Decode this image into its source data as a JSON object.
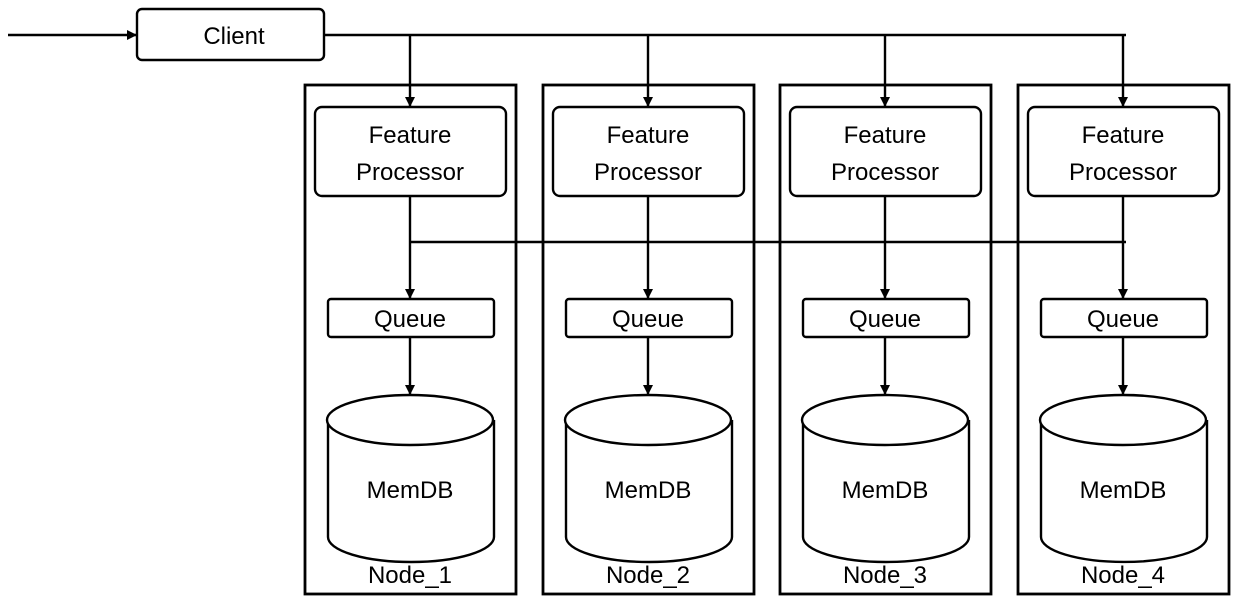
{
  "diagram": {
    "client": {
      "label": "Client"
    },
    "nodes": [
      {
        "name": "Node_1",
        "processor": [
          "Feature",
          "Processor"
        ],
        "queue": "Queue",
        "db": "MemDB"
      },
      {
        "name": "Node_2",
        "processor": [
          "Feature",
          "Processor"
        ],
        "queue": "Queue",
        "db": "MemDB"
      },
      {
        "name": "Node_3",
        "processor": [
          "Feature",
          "Processor"
        ],
        "queue": "Queue",
        "db": "MemDB"
      },
      {
        "name": "Node_4",
        "processor": [
          "Feature",
          "Processor"
        ],
        "queue": "Queue",
        "db": "MemDB"
      }
    ],
    "colors": {
      "line": "#000000",
      "background": "#ffffff"
    }
  }
}
